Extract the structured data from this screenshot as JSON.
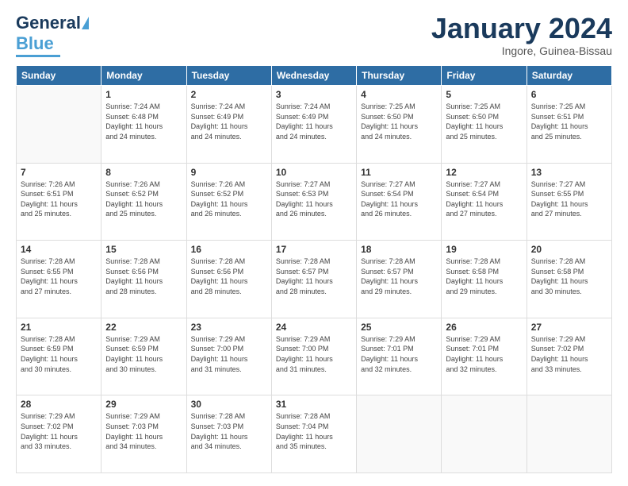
{
  "header": {
    "logo_general": "General",
    "logo_blue": "Blue",
    "month_title": "January 2024",
    "location": "Ingore, Guinea-Bissau"
  },
  "days_of_week": [
    "Sunday",
    "Monday",
    "Tuesday",
    "Wednesday",
    "Thursday",
    "Friday",
    "Saturday"
  ],
  "weeks": [
    [
      {
        "day": "",
        "info": ""
      },
      {
        "day": "1",
        "info": "Sunrise: 7:24 AM\nSunset: 6:48 PM\nDaylight: 11 hours\nand 24 minutes."
      },
      {
        "day": "2",
        "info": "Sunrise: 7:24 AM\nSunset: 6:49 PM\nDaylight: 11 hours\nand 24 minutes."
      },
      {
        "day": "3",
        "info": "Sunrise: 7:24 AM\nSunset: 6:49 PM\nDaylight: 11 hours\nand 24 minutes."
      },
      {
        "day": "4",
        "info": "Sunrise: 7:25 AM\nSunset: 6:50 PM\nDaylight: 11 hours\nand 24 minutes."
      },
      {
        "day": "5",
        "info": "Sunrise: 7:25 AM\nSunset: 6:50 PM\nDaylight: 11 hours\nand 25 minutes."
      },
      {
        "day": "6",
        "info": "Sunrise: 7:25 AM\nSunset: 6:51 PM\nDaylight: 11 hours\nand 25 minutes."
      }
    ],
    [
      {
        "day": "7",
        "info": "Sunrise: 7:26 AM\nSunset: 6:51 PM\nDaylight: 11 hours\nand 25 minutes."
      },
      {
        "day": "8",
        "info": "Sunrise: 7:26 AM\nSunset: 6:52 PM\nDaylight: 11 hours\nand 25 minutes."
      },
      {
        "day": "9",
        "info": "Sunrise: 7:26 AM\nSunset: 6:52 PM\nDaylight: 11 hours\nand 26 minutes."
      },
      {
        "day": "10",
        "info": "Sunrise: 7:27 AM\nSunset: 6:53 PM\nDaylight: 11 hours\nand 26 minutes."
      },
      {
        "day": "11",
        "info": "Sunrise: 7:27 AM\nSunset: 6:54 PM\nDaylight: 11 hours\nand 26 minutes."
      },
      {
        "day": "12",
        "info": "Sunrise: 7:27 AM\nSunset: 6:54 PM\nDaylight: 11 hours\nand 27 minutes."
      },
      {
        "day": "13",
        "info": "Sunrise: 7:27 AM\nSunset: 6:55 PM\nDaylight: 11 hours\nand 27 minutes."
      }
    ],
    [
      {
        "day": "14",
        "info": "Sunrise: 7:28 AM\nSunset: 6:55 PM\nDaylight: 11 hours\nand 27 minutes."
      },
      {
        "day": "15",
        "info": "Sunrise: 7:28 AM\nSunset: 6:56 PM\nDaylight: 11 hours\nand 28 minutes."
      },
      {
        "day": "16",
        "info": "Sunrise: 7:28 AM\nSunset: 6:56 PM\nDaylight: 11 hours\nand 28 minutes."
      },
      {
        "day": "17",
        "info": "Sunrise: 7:28 AM\nSunset: 6:57 PM\nDaylight: 11 hours\nand 28 minutes."
      },
      {
        "day": "18",
        "info": "Sunrise: 7:28 AM\nSunset: 6:57 PM\nDaylight: 11 hours\nand 29 minutes."
      },
      {
        "day": "19",
        "info": "Sunrise: 7:28 AM\nSunset: 6:58 PM\nDaylight: 11 hours\nand 29 minutes."
      },
      {
        "day": "20",
        "info": "Sunrise: 7:28 AM\nSunset: 6:58 PM\nDaylight: 11 hours\nand 30 minutes."
      }
    ],
    [
      {
        "day": "21",
        "info": "Sunrise: 7:28 AM\nSunset: 6:59 PM\nDaylight: 11 hours\nand 30 minutes."
      },
      {
        "day": "22",
        "info": "Sunrise: 7:29 AM\nSunset: 6:59 PM\nDaylight: 11 hours\nand 30 minutes."
      },
      {
        "day": "23",
        "info": "Sunrise: 7:29 AM\nSunset: 7:00 PM\nDaylight: 11 hours\nand 31 minutes."
      },
      {
        "day": "24",
        "info": "Sunrise: 7:29 AM\nSunset: 7:00 PM\nDaylight: 11 hours\nand 31 minutes."
      },
      {
        "day": "25",
        "info": "Sunrise: 7:29 AM\nSunset: 7:01 PM\nDaylight: 11 hours\nand 32 minutes."
      },
      {
        "day": "26",
        "info": "Sunrise: 7:29 AM\nSunset: 7:01 PM\nDaylight: 11 hours\nand 32 minutes."
      },
      {
        "day": "27",
        "info": "Sunrise: 7:29 AM\nSunset: 7:02 PM\nDaylight: 11 hours\nand 33 minutes."
      }
    ],
    [
      {
        "day": "28",
        "info": "Sunrise: 7:29 AM\nSunset: 7:02 PM\nDaylight: 11 hours\nand 33 minutes."
      },
      {
        "day": "29",
        "info": "Sunrise: 7:29 AM\nSunset: 7:03 PM\nDaylight: 11 hours\nand 34 minutes."
      },
      {
        "day": "30",
        "info": "Sunrise: 7:28 AM\nSunset: 7:03 PM\nDaylight: 11 hours\nand 34 minutes."
      },
      {
        "day": "31",
        "info": "Sunrise: 7:28 AM\nSunset: 7:04 PM\nDaylight: 11 hours\nand 35 minutes."
      },
      {
        "day": "",
        "info": ""
      },
      {
        "day": "",
        "info": ""
      },
      {
        "day": "",
        "info": ""
      }
    ]
  ]
}
